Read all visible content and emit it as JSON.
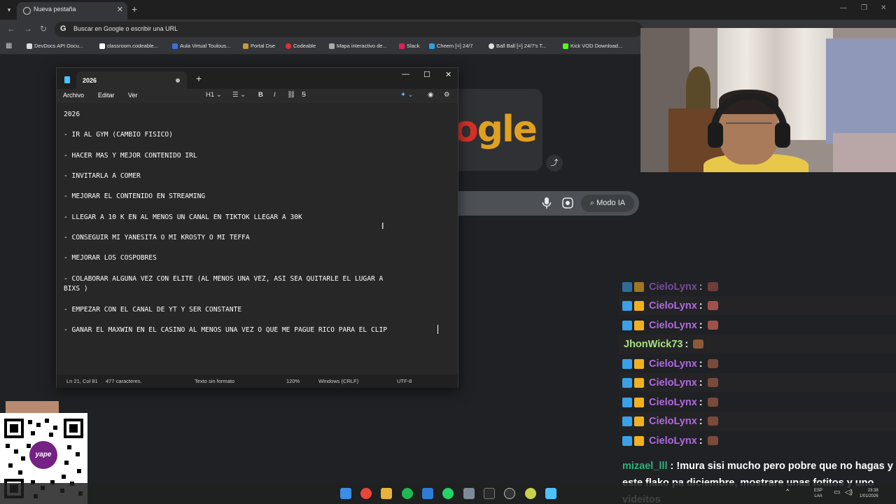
{
  "browser": {
    "tab_title": "Nueva pestaña",
    "omnibox_placeholder": "Buscar en Google o escribir una URL",
    "bookmarks": [
      {
        "label": "DevDocs API Docu..."
      },
      {
        "label": "classroom.codeable..."
      },
      {
        "label": "Aula Virtual Toulous..."
      },
      {
        "label": "Portal Dse"
      },
      {
        "label": "Codeable"
      },
      {
        "label": "Mapa interactivo de..."
      },
      {
        "label": "Slack"
      },
      {
        "label": "Cheem [=] 24/7"
      },
      {
        "label": "Ball Ball [=] 24/7's T..."
      },
      {
        "label": "Kick VOD Download..."
      }
    ]
  },
  "google": {
    "logo_partial": "gle",
    "logo_red": "o",
    "modo_ia": "Modo IA"
  },
  "notepad": {
    "tab_title": "2026",
    "menu": {
      "file": "Archivo",
      "edit": "Editar",
      "view": "Ver"
    },
    "toolbar": {
      "heading": "H1",
      "bold": "B",
      "italic": "I"
    },
    "lines": [
      "2026",
      "- IR AL GYM (CAMBIO FISICO)",
      "- HACER MAS Y MEJOR CONTENIDO IRL",
      "- INVITARLA A COMER",
      "- MEJORAR EL CONTENIDO EN STREAMING",
      "- LLEGAR A 10 K EN AL MENOS UN CANAL EN TIKTOK LLEGAR A 30K",
      "- CONSEGUIR MI YANESITA O MI KROSTY O MI TEFFA",
      "- MEJORAR LOS COSPOBRES",
      "- COLABORAR ALGUNA VEZ CON ELITE (AL MENOS UNA VEZ, ASI SEA QUITARLE EL LUGAR A",
      "BIXS )",
      "- EMPEZAR CON EL CANAL DE YT Y SER CONSTANTE",
      "- GANAR EL MAXWIN EN EL CASINO AL MENOS UNA VEZ O QUE ME PAGUE RICO PARA EL CLIP"
    ],
    "status": {
      "position": "Ln 21, Col 81",
      "chars": "477 caracteres.",
      "format": "Texto sin formato",
      "zoom": "120%",
      "line_endings": "Windows (CRLF)",
      "encoding": "UTF-8"
    }
  },
  "chat": {
    "rows": [
      {
        "user": "CieloLynx",
        "color": "#b06ae0",
        "badges": true
      },
      {
        "user": "CieloLynx",
        "color": "#b06ae0",
        "badges": true
      },
      {
        "user": "CieloLynx",
        "color": "#b06ae0",
        "badges": true
      },
      {
        "user": "JhonWick73",
        "color": "#a8e080",
        "badges": false
      },
      {
        "user": "CieloLynx",
        "color": "#b06ae0",
        "badges": true
      },
      {
        "user": "CieloLynx",
        "color": "#b06ae0",
        "badges": true
      },
      {
        "user": "CieloLynx",
        "color": "#b06ae0",
        "badges": true
      },
      {
        "user": "CieloLynx",
        "color": "#b06ae0",
        "badges": true
      },
      {
        "user": "CieloLynx",
        "color": "#b06ae0",
        "badges": true
      }
    ],
    "last_message": {
      "user": "mizael_lll",
      "text": "!mura sisi mucho pero pobre que no hagas y este flako pa diciembre, mostrare unas fotitos y uno videitos"
    }
  },
  "taskbar": {
    "lang_top": "ESP",
    "lang_bottom": "LAA",
    "time": "23:38",
    "date": "1/01/2026"
  },
  "qr": {
    "brand": "yape"
  }
}
